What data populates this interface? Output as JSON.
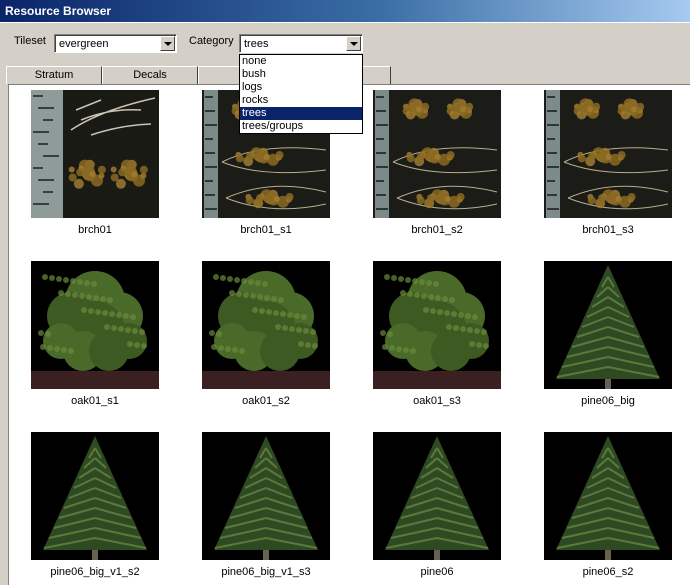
{
  "window": {
    "title": "Resource Browser"
  },
  "tileset": {
    "label": "Tileset",
    "value": "evergreen"
  },
  "category": {
    "label": "Category",
    "value": "trees",
    "options": [
      "none",
      "bush",
      "logs",
      "rocks",
      "trees",
      "trees/groups"
    ],
    "selected_index": 4
  },
  "tabs": [
    {
      "label": "Stratum"
    },
    {
      "label": "Decals"
    },
    {
      "label": "S"
    },
    {
      "label": ""
    }
  ],
  "items": [
    {
      "name": "brch01",
      "kind": "birch-sheet"
    },
    {
      "name": "brch01_s1",
      "kind": "birch-strip"
    },
    {
      "name": "brch01_s2",
      "kind": "birch-strip"
    },
    {
      "name": "brch01_s3",
      "kind": "birch-strip"
    },
    {
      "name": "oak01_s1",
      "kind": "oak"
    },
    {
      "name": "oak01_s2",
      "kind": "oak"
    },
    {
      "name": "oak01_s3",
      "kind": "oak"
    },
    {
      "name": "pine06_big",
      "kind": "pine"
    },
    {
      "name": "pine06_big_v1_s2",
      "kind": "pine"
    },
    {
      "name": "pine06_big_v1_s3",
      "kind": "pine"
    },
    {
      "name": "pine06",
      "kind": "pine"
    },
    {
      "name": "pine06_s2",
      "kind": "pine"
    }
  ]
}
